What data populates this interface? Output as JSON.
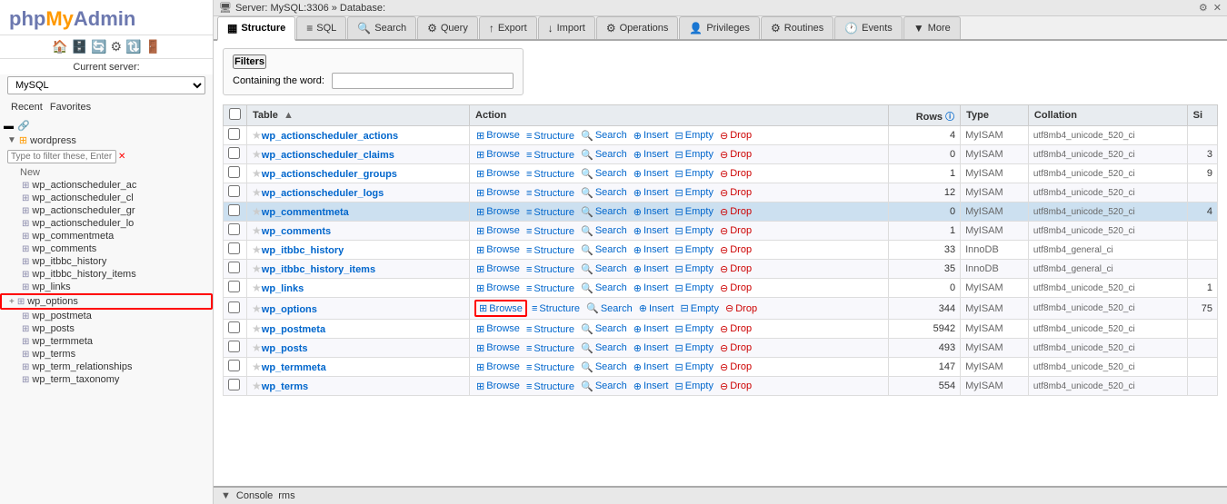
{
  "sidebar": {
    "logo": {
      "php": "php",
      "my": "My",
      "admin": "Admin"
    },
    "current_server_label": "Current server:",
    "server_options": [
      "MySQL"
    ],
    "server_selected": "MySQL",
    "recent_label": "Recent",
    "favorites_label": "Favorites",
    "filter_placeholder": "Type to filter these, Enter to se",
    "new_label": "New",
    "database": {
      "name": "wordpress",
      "icon": "⊞",
      "tables": [
        {
          "name": "wp_actionscheduler_ac",
          "selected": false,
          "highlight_box": false
        },
        {
          "name": "wp_actionscheduler_cl",
          "selected": false,
          "highlight_box": false
        },
        {
          "name": "wp_actionscheduler_gr",
          "selected": false,
          "highlight_box": false
        },
        {
          "name": "wp_actionscheduler_lo",
          "selected": false,
          "highlight_box": false
        },
        {
          "name": "wp_commentmeta",
          "selected": false,
          "highlight_box": false
        },
        {
          "name": "wp_comments",
          "selected": false,
          "highlight_box": false
        },
        {
          "name": "wp_itbbc_history",
          "selected": false,
          "highlight_box": false
        },
        {
          "name": "wp_itbbc_history_items",
          "selected": false,
          "highlight_box": false
        },
        {
          "name": "wp_links",
          "selected": false,
          "highlight_box": false
        },
        {
          "name": "wp_options",
          "selected": false,
          "highlight_box": true
        },
        {
          "name": "wp_postmeta",
          "selected": false,
          "highlight_box": false
        },
        {
          "name": "wp_posts",
          "selected": false,
          "highlight_box": false
        },
        {
          "name": "wp_termmeta",
          "selected": false,
          "highlight_box": false
        },
        {
          "name": "wp_terms",
          "selected": false,
          "highlight_box": false
        },
        {
          "name": "wp_term_relationships",
          "selected": false,
          "highlight_box": false
        },
        {
          "name": "wp_term_taxonomy",
          "selected": false,
          "highlight_box": false
        }
      ]
    }
  },
  "topbar": {
    "breadcrumb": "Server: MySQL:3306 » Database:",
    "settings_icon": "⚙",
    "exit_icon": "✕"
  },
  "tabs": [
    {
      "id": "structure",
      "label": "Structure",
      "icon": "▦",
      "active": true
    },
    {
      "id": "sql",
      "label": "SQL",
      "icon": "≡"
    },
    {
      "id": "search",
      "label": "Search",
      "icon": "🔍"
    },
    {
      "id": "query",
      "label": "Query",
      "icon": "⚙"
    },
    {
      "id": "export",
      "label": "Export",
      "icon": "↑"
    },
    {
      "id": "import",
      "label": "Import",
      "icon": "↓"
    },
    {
      "id": "operations",
      "label": "Operations",
      "icon": "⚙"
    },
    {
      "id": "privileges",
      "label": "Privileges",
      "icon": "👤"
    },
    {
      "id": "routines",
      "label": "Routines",
      "icon": "⚙"
    },
    {
      "id": "events",
      "label": "Events",
      "icon": "🕐"
    },
    {
      "id": "more",
      "label": "More",
      "icon": "▼"
    }
  ],
  "filters": {
    "button_label": "Filters",
    "containing_label": "Containing the word:",
    "input_value": "",
    "input_placeholder": ""
  },
  "table_headers": {
    "checkbox": "",
    "table": "Table",
    "action": "Action",
    "rows": "Rows",
    "rows_info": "ⓘ",
    "type": "Type",
    "collation": "Collation",
    "size": "Si"
  },
  "tables": [
    {
      "name": "wp_actionscheduler_actions",
      "rows": 4,
      "type": "MyISAM",
      "collation": "utf8mb4_unicode_520_ci",
      "size": "",
      "highlighted": false,
      "highlight_browse": false
    },
    {
      "name": "wp_actionscheduler_claims",
      "rows": 0,
      "type": "MyISAM",
      "collation": "utf8mb4_unicode_520_ci",
      "size": "3",
      "highlighted": false,
      "highlight_browse": false
    },
    {
      "name": "wp_actionscheduler_groups",
      "rows": 1,
      "type": "MyISAM",
      "collation": "utf8mb4_unicode_520_ci",
      "size": "9",
      "highlighted": false,
      "highlight_browse": false
    },
    {
      "name": "wp_actionscheduler_logs",
      "rows": 12,
      "type": "MyISAM",
      "collation": "utf8mb4_unicode_520_ci",
      "size": "",
      "highlighted": false,
      "highlight_browse": false
    },
    {
      "name": "wp_commentmeta",
      "rows": 0,
      "type": "MyISAM",
      "collation": "utf8mb4_unicode_520_ci",
      "size": "4",
      "highlighted": true,
      "highlight_browse": false
    },
    {
      "name": "wp_comments",
      "rows": 1,
      "type": "MyISAM",
      "collation": "utf8mb4_unicode_520_ci",
      "size": "",
      "highlighted": false,
      "highlight_browse": false
    },
    {
      "name": "wp_itbbc_history",
      "rows": 33,
      "type": "InnoDB",
      "collation": "utf8mb4_general_ci",
      "size": "",
      "highlighted": false,
      "highlight_browse": false
    },
    {
      "name": "wp_itbbc_history_items",
      "rows": 35,
      "type": "InnoDB",
      "collation": "utf8mb4_general_ci",
      "size": "",
      "highlighted": false,
      "highlight_browse": false
    },
    {
      "name": "wp_links",
      "rows": 0,
      "type": "MyISAM",
      "collation": "utf8mb4_unicode_520_ci",
      "size": "1",
      "highlighted": false,
      "highlight_browse": false
    },
    {
      "name": "wp_options",
      "rows": 344,
      "type": "MyISAM",
      "collation": "utf8mb4_unicode_520_ci",
      "size": "75",
      "highlighted": false,
      "highlight_browse": true
    },
    {
      "name": "wp_postmeta",
      "rows": 5942,
      "type": "MyISAM",
      "collation": "utf8mb4_unicode_520_ci",
      "size": "",
      "highlighted": false,
      "highlight_browse": false
    },
    {
      "name": "wp_posts",
      "rows": 493,
      "type": "MyISAM",
      "collation": "utf8mb4_unicode_520_ci",
      "size": "",
      "highlighted": false,
      "highlight_browse": false
    },
    {
      "name": "wp_termmeta",
      "rows": 147,
      "type": "MyISAM",
      "collation": "utf8mb4_unicode_520_ci",
      "size": "",
      "highlighted": false,
      "highlight_browse": false
    },
    {
      "name": "wp_terms",
      "rows": 554,
      "type": "MyISAM",
      "collation": "utf8mb4_unicode_520_ci",
      "size": "",
      "highlighted": false,
      "highlight_browse": false
    }
  ],
  "action_labels": {
    "browse": "Browse",
    "structure": "Structure",
    "search": "Search",
    "insert": "Insert",
    "empty": "Empty",
    "drop": "Drop"
  },
  "console": {
    "label": "Console"
  }
}
